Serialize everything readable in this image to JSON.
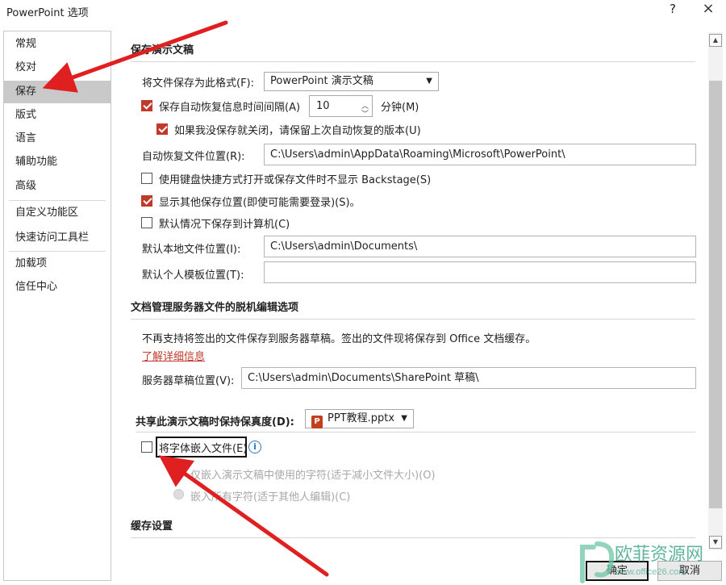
{
  "window": {
    "title": "PowerPoint 选项",
    "help": "?",
    "close": "×"
  },
  "sidebar": {
    "items": [
      {
        "label": "常规"
      },
      {
        "label": "校对"
      },
      {
        "label": "保存"
      },
      {
        "label": "版式"
      },
      {
        "label": "语言"
      },
      {
        "label": "辅助功能"
      },
      {
        "label": "高级"
      },
      {
        "label": "自定义功能区"
      },
      {
        "label": "快速访问工具栏"
      },
      {
        "label": "加载项"
      },
      {
        "label": "信任中心"
      }
    ]
  },
  "save": {
    "heading": "保存演示文稿",
    "format_label": "将文件保存为此格式(F):",
    "format_value": "PowerPoint 演示文稿",
    "autorecover_label": "保存自动恢复信息时间间隔(A)",
    "autorecover_checked": true,
    "autorecover_minutes": "10",
    "minutes_label": "分钟(M)",
    "keep_last_label": "如果我没保存就关闭，请保留上次自动恢复的版本(U)",
    "keep_last_checked": true,
    "autorecover_location_label": "自动恢复文件位置(R):",
    "autorecover_location_value": "C:\\Users\\admin\\AppData\\Roaming\\Microsoft\\PowerPoint\\",
    "backstage_label": "使用键盘快捷方式打开或保存文件时不显示 Backstage(S)",
    "backstage_checked": false,
    "show_other_label": "显示其他保存位置(即使可能需要登录)(S)。",
    "show_other_checked": true,
    "save_computer_label": "默认情况下保存到计算机(C)",
    "save_computer_checked": false,
    "local_location_label": "默认本地文件位置(I):",
    "local_location_value": "C:\\Users\\admin\\Documents\\",
    "template_location_label": "默认个人模板位置(T):",
    "template_location_value": ""
  },
  "offline": {
    "heading": "文档管理服务器文件的脱机编辑选项",
    "description": "不再支持将签出的文件保存到服务器草稿。签出的文件现将保存到 Office 文档缓存。",
    "learn_more": "了解详细信息",
    "drafts_label": "服务器草稿位置(V):",
    "drafts_value": "C:\\Users\\admin\\Documents\\SharePoint 草稿\\"
  },
  "fidelity": {
    "heading": "共享此演示文稿时保持保真度(D):",
    "file_name": "PPT教程.pptx",
    "file_icon": "P",
    "embed_label": "将字体嵌入文件(E)",
    "embed_checked": false,
    "info_glyph": "i",
    "option_used_label": "仅嵌入演示文稿中使用的字符(适于减小文件大小)(O)",
    "option_all_label": "嵌入所有字符(适于其他人编辑)(C)"
  },
  "cache": {
    "heading": "缓存设置"
  },
  "buttons": {
    "ok": "确定",
    "cancel": "取消"
  },
  "watermark": {
    "text": "欧菲资源网",
    "url": "www.office26.com"
  },
  "colors": {
    "accent": "#c0392b",
    "arrow": "#e02020",
    "selected_bg": "#c9c9c9"
  }
}
